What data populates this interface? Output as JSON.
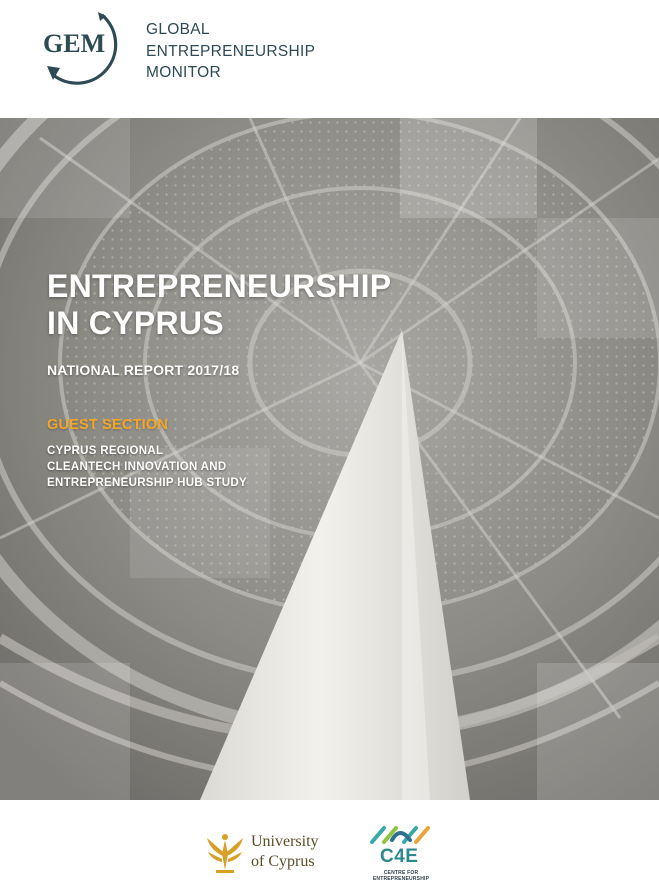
{
  "header": {
    "logo": {
      "text": "GEM",
      "icon": "gem-circular-arrow-logo",
      "color": "#2e4a55"
    },
    "org_name_lines": [
      "GLOBAL",
      "ENTREPRENEURSHIP",
      "MONITOR"
    ]
  },
  "cover": {
    "image": "museum-dome-interior-with-white-column",
    "title_lines": [
      "ENTREPRENEURSHIP",
      "IN CYPRUS"
    ],
    "subtitle": "NATIONAL REPORT 2017/18",
    "guest_section": {
      "heading": "GUEST SECTION",
      "heading_color": "#f5a623",
      "body_lines": [
        "CYPRUS REGIONAL",
        "CLEANTECH INNOVATION AND",
        "ENTREPRENEURSHIP HUB STUDY"
      ]
    }
  },
  "footer": {
    "university_logo": {
      "icon": "university-of-cyprus-crest",
      "name_lines": [
        "University",
        "of Cyprus"
      ],
      "color": "#5a4d28"
    },
    "c4e_logo": {
      "icon": "c4e-logo",
      "name": "C4E",
      "tagline": "CENTRE FOR ENTREPRENEURSHIP",
      "color": "#2a8a8c"
    }
  }
}
